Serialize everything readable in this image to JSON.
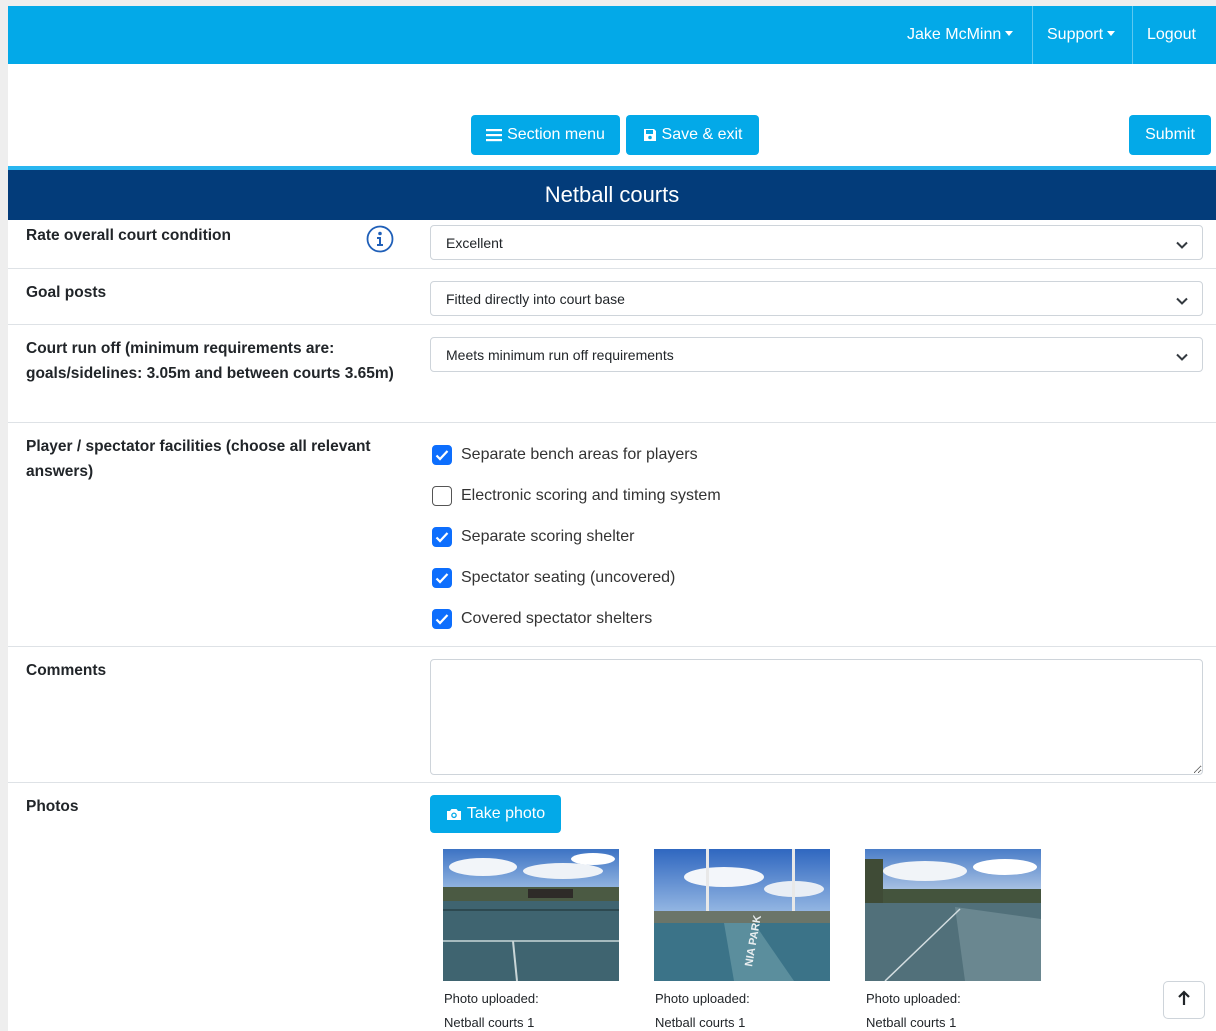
{
  "nav": {
    "user": "Jake McMinn",
    "support": "Support",
    "logout": "Logout"
  },
  "toolbar": {
    "section_menu": "Section menu",
    "save_exit": "Save & exit",
    "submit": "Submit"
  },
  "section": {
    "title": "Netball courts"
  },
  "fields": {
    "court_condition": {
      "label": "Rate overall court condition",
      "value": "Excellent"
    },
    "goal_posts": {
      "label": "Goal posts",
      "value": "Fitted directly into court base"
    },
    "run_off": {
      "label": "Court run off (minimum requirements are: goals/sidelines: 3.05m and between courts 3.65m)",
      "value": "Meets minimum run off requirements"
    },
    "facilities": {
      "label": "Player / spectator facilities (choose all relevant answers)",
      "options": [
        {
          "label": "Separate bench areas for players",
          "checked": true
        },
        {
          "label": "Electronic scoring and timing system",
          "checked": false
        },
        {
          "label": "Separate scoring shelter",
          "checked": true
        },
        {
          "label": "Spectator seating (uncovered)",
          "checked": true
        },
        {
          "label": "Covered spectator shelters",
          "checked": true
        }
      ]
    },
    "comments": {
      "label": "Comments",
      "value": ""
    },
    "photos": {
      "label": "Photos",
      "take_photo": "Take photo",
      "items": [
        {
          "status": "Photo uploaded:",
          "name": "Netball courts 1"
        },
        {
          "status": "Photo uploaded:",
          "name": "Netball courts 1"
        },
        {
          "status": "Photo uploaded:",
          "name": "Netball courts 1"
        }
      ]
    }
  },
  "colors": {
    "primary": "#03a9e8",
    "header": "#033c7a",
    "checkbox": "#0d6efd"
  },
  "icons": {
    "menu": "hamburger-icon",
    "save": "floppy-disk-icon",
    "camera": "camera-icon",
    "info": "info-icon",
    "chevron": "chevron-down-icon",
    "scroll_top": "arrow-up-icon"
  }
}
